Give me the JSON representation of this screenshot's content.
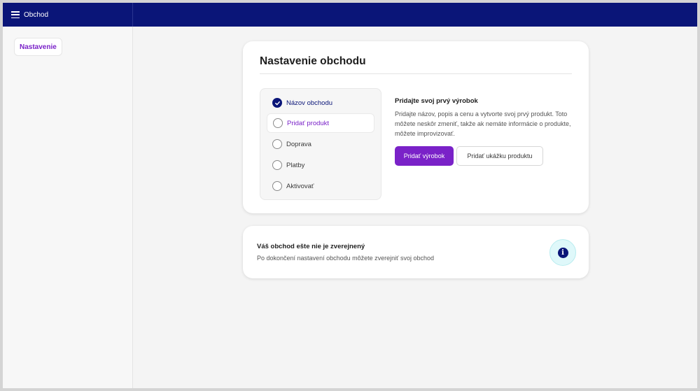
{
  "header": {
    "app_title": "Obchod",
    "menu_icon": "hamburger-icon",
    "color": "#0a1578"
  },
  "sidebar": {
    "items": [
      {
        "label": "Nastavenie"
      }
    ]
  },
  "setup": {
    "title": "Nastavenie obchodu",
    "steps": [
      {
        "label": "Názov obchodu",
        "state": "done"
      },
      {
        "label": "Pridať produkt",
        "state": "active"
      },
      {
        "label": "Doprava",
        "state": "pending"
      },
      {
        "label": "Platby",
        "state": "pending"
      },
      {
        "label": "Aktivovať",
        "state": "pending"
      }
    ],
    "detail": {
      "title": "Pridajte svoj prvý výrobok",
      "text": "Pridajte názov, popis a cenu a vytvorte svoj prvý produkt. Toto môžete neskôr zmeniť, takže ak nemáte informácie o produkte, môžete improvizovať."
    },
    "primary_button": "Pridať výrobok",
    "secondary_button": "Pridať ukážku produktu",
    "accent_color": "#7a22c8"
  },
  "notice": {
    "title": "Váš obchod ešte nie je zverejnený",
    "text": "Po dokončení nastavení obchodu môžete zverejniť svoj obchod",
    "icon": "info-icon",
    "icon_glyph": "i"
  }
}
